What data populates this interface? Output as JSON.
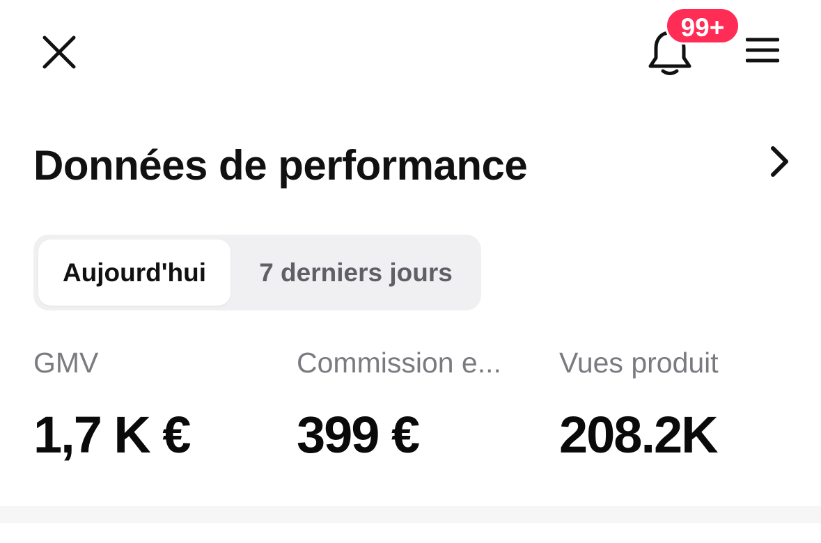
{
  "topbar": {
    "close_icon": "close-icon",
    "bell_icon": "bell-icon",
    "notification_badge": "99+",
    "menu_icon": "hamburger-menu-icon"
  },
  "section": {
    "title": "Données de performance",
    "chevron_icon": "chevron-right-icon"
  },
  "tabs": [
    {
      "label": "Aujourd'hui",
      "selected": true
    },
    {
      "label": "7 derniers jours",
      "selected": false
    }
  ],
  "metrics": [
    {
      "label": "GMV",
      "value": "1,7 K €"
    },
    {
      "label": "Commission e...",
      "value": "399 €"
    },
    {
      "label": "Vues produit",
      "value": "208.2K"
    }
  ],
  "colors": {
    "badge": "#ff2d55",
    "text_primary": "#111111",
    "text_secondary": "#7a7a80",
    "segment_bg": "#f0f0f2"
  }
}
